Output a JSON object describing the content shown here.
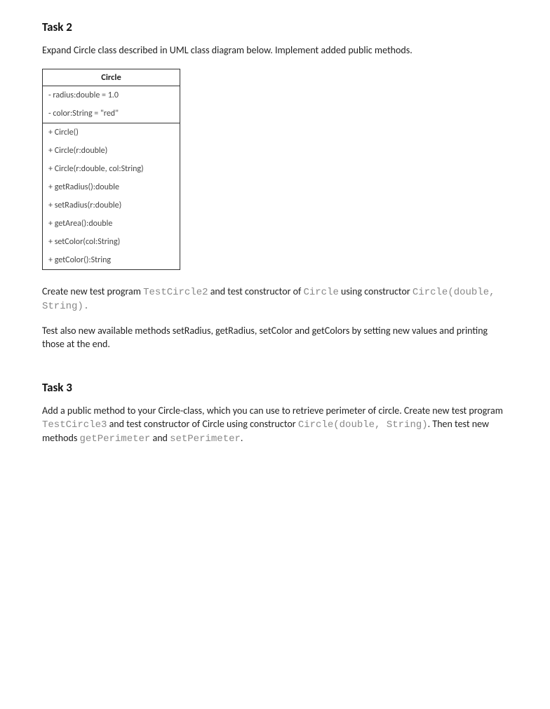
{
  "task2": {
    "heading": "Task 2",
    "intro": "Expand Circle class described in UML class diagram below. Implement added public methods.",
    "uml": {
      "className": "Circle",
      "attributes": [
        "- radius:double = 1.0",
        "- color:String = \"red\""
      ],
      "methods": [
        "+ Circle()",
        "+ Circle(r:double)",
        "+ Circle(r:double, col:String)",
        "+ getRadius():double",
        "+ setRadius(r:double)",
        "+ getArea():double",
        "+ setColor(col:String)",
        "+ getColor():String"
      ]
    },
    "p2_a": "Create new test program ",
    "p2_code1": "TestCircle2",
    "p2_b": " and test constructor of ",
    "p2_code2": "Circle",
    "p2_c": "  using constructor ",
    "p2_code3": "Circle(double, String).",
    "p3": "Test also new available methods setRadius, getRadius, setColor and getColors by setting new values and printing those at the end."
  },
  "task3": {
    "heading": "Task 3",
    "p1_a": "Add a public method to your Circle-class, which you can use to retrieve perimeter of circle. Create new test program ",
    "p1_code1": "TestCircle3",
    "p1_b": " and test constructor of Circle using constructor ",
    "p1_code2": "Circle(double, String)",
    "p1_c": ". Then test new methods ",
    "p1_code3": "getPerimeter",
    "p1_d": " and ",
    "p1_code4": "setPerimeter",
    "p1_e": "."
  }
}
